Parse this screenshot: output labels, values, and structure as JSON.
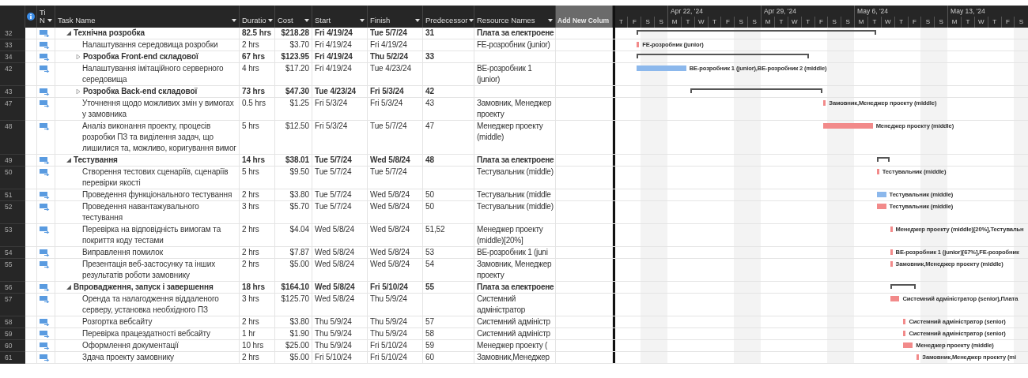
{
  "columns": [
    {
      "label": "Ti N",
      "kind": "field"
    },
    {
      "label": "Task Name",
      "kind": "field"
    },
    {
      "label": "Duratio",
      "kind": "field"
    },
    {
      "label": "Cost",
      "kind": "field"
    },
    {
      "label": "Start",
      "kind": "field"
    },
    {
      "label": "Finish",
      "kind": "field"
    },
    {
      "label": "Predecessor",
      "kind": "field"
    },
    {
      "label": "Resource Names",
      "kind": "field"
    },
    {
      "label": "Add New Colum",
      "kind": "add"
    }
  ],
  "timeline": {
    "weeks": [
      "Apr 22, '24",
      "Apr 29, '24",
      "May 6, '24",
      "May 13, '24"
    ],
    "days": [
      "T",
      "F",
      "S",
      "S",
      "M",
      "T",
      "W",
      "T",
      "F",
      "S",
      "S",
      "M",
      "T",
      "W",
      "T",
      "F",
      "S",
      "S",
      "M",
      "T",
      "W",
      "T",
      "F",
      "S",
      "S",
      "M",
      "T",
      "W",
      "T",
      "F",
      "S"
    ]
  },
  "tasks": [
    {
      "id": "32",
      "kind": "summary",
      "expanded": true,
      "name": "Технічна розробка",
      "duration": "82.5 hrs",
      "cost": "$218.28",
      "start": "Fri 4/19/24",
      "finish": "Tue 5/7/24",
      "predecessors": "31",
      "resources": "Плата за електроене",
      "children": [
        {
          "id": "33",
          "kind": "task",
          "name": "Налаштування середовища розробки",
          "duration": "2 hrs",
          "cost": "$3.70",
          "start": "Fri 4/19/24",
          "finish": "Fri 4/19/24",
          "resources": "FE-розробник (junior)",
          "critical": true,
          "bar_label": "FE-розробник (junior)"
        },
        {
          "id": "34",
          "kind": "summary",
          "expanded": false,
          "name": "Розробка Front-end складової",
          "duration": "67 hrs",
          "cost": "$123.95",
          "start": "Fri 4/19/24",
          "finish": "Thu 5/2/24",
          "predecessors": "33"
        },
        {
          "id": "42",
          "kind": "task",
          "name": "Налаштування імітаційного серверного середовища",
          "duration": "4 hrs",
          "cost": "$17.20",
          "start": "Fri 4/19/24",
          "finish": "Tue 4/23/24",
          "resources": "BE-розробник 1 (junior)",
          "critical": false,
          "bar_label": "BE-розробник 1 (junior),BE-розробник 2 (middle)"
        },
        {
          "id": "43",
          "kind": "summary",
          "expanded": false,
          "name": "Розробка Back-end складової",
          "duration": "73 hrs",
          "cost": "$47.30",
          "start": "Tue 4/23/24",
          "finish": "Fri 5/3/24",
          "predecessors": "42"
        },
        {
          "id": "47",
          "kind": "task",
          "name": "Уточнення щодо можливих змін у вимогах у замовника",
          "duration": "0.5 hrs",
          "cost": "$1.25",
          "start": "Fri 5/3/24",
          "finish": "Fri 5/3/24",
          "predecessors": "43",
          "resources": "Замовник, Менеджер проекту",
          "critical": true,
          "bar_label": "Замовник,Менеджер проекту (middle)"
        },
        {
          "id": "48",
          "kind": "task",
          "name": "Аналіз виконання проекту, процесів розробки ПЗ та виділення задач, що лишилися та, можливо, коригування вимог",
          "duration": "5 hrs",
          "cost": "$12.50",
          "start": "Fri 5/3/24",
          "finish": "Tue 5/7/24",
          "predecessors": "47",
          "resources": "Менеджер проекту (middle)",
          "critical": true,
          "bar_label": "Менеджер проекту (middle)"
        }
      ]
    },
    {
      "id": "49",
      "kind": "summary",
      "expanded": true,
      "name": "Тестування",
      "duration": "14 hrs",
      "cost": "$38.01",
      "start": "Tue 5/7/24",
      "finish": "Wed 5/8/24",
      "predecessors": "48",
      "resources": "Плата за електроене",
      "children": [
        {
          "id": "50",
          "kind": "task",
          "name": "Створення тестових сценаріїв, сценаріїв перевірки якості",
          "duration": "5 hrs",
          "cost": "$9.50",
          "start": "Tue 5/7/24",
          "finish": "Tue 5/7/24",
          "resources": "Тестувальник (middle)",
          "critical": true,
          "bar_label": "Тестувальник (middle)"
        },
        {
          "id": "51",
          "kind": "task",
          "name": "Проведення функціонального тестування",
          "duration": "2 hrs",
          "cost": "$3.80",
          "start": "Tue 5/7/24",
          "finish": "Wed 5/8/24",
          "predecessors": "50",
          "resources": "Тестувальник (middle",
          "critical": false,
          "bar_label": "Тестувальник (middle)"
        },
        {
          "id": "52",
          "kind": "task",
          "name": "Проведення навантажувального тестування",
          "duration": "3 hrs",
          "cost": "$5.70",
          "start": "Tue 5/7/24",
          "finish": "Wed 5/8/24",
          "predecessors": "50",
          "resources": "Тестувальник (middle)",
          "critical": true,
          "bar_label": "Тестувальник (middle)"
        },
        {
          "id": "53",
          "kind": "task",
          "name": "Перевірка на відповідність вимогам та покриття коду тестами",
          "duration": "2 hrs",
          "cost": "$4.04",
          "start": "Wed 5/8/24",
          "finish": "Wed 5/8/24",
          "predecessors": "51,52",
          "resources": "Менеджер проекту (middle)[20%]",
          "critical": true,
          "bar_label": "Менеджер проекту (middle)[20%],Тестувальн"
        },
        {
          "id": "54",
          "kind": "task",
          "name": "Виправлення помилок",
          "duration": "2 hrs",
          "cost": "$7.87",
          "start": "Wed 5/8/24",
          "finish": "Wed 5/8/24",
          "predecessors": "53",
          "resources": "BE-розробник 1 (juni",
          "critical": true,
          "bar_label": "BE-розробник 1 (junior)[67%],FE-розробник"
        },
        {
          "id": "55",
          "kind": "task",
          "name": "Презентація веб-застосунку та інших результатів роботи замовнику",
          "duration": "2 hrs",
          "cost": "$5.00",
          "start": "Wed 5/8/24",
          "finish": "Wed 5/8/24",
          "predecessors": "54",
          "resources": "Замовник, Менеджер проекту",
          "critical": true,
          "bar_label": "Замовник,Менеджер проекту (middle)"
        }
      ]
    },
    {
      "id": "56",
      "kind": "summary",
      "expanded": true,
      "name": "Впровадження, запуск і завершення",
      "duration": "18 hrs",
      "cost": "$164.10",
      "start": "Wed 5/8/24",
      "finish": "Fri 5/10/24",
      "predecessors": "55",
      "resources": "Плата за електроене",
      "children": [
        {
          "id": "57",
          "kind": "task",
          "name": "Оренда та налагодження віддаленого серверу, установка необхідного ПЗ",
          "duration": "3 hrs",
          "cost": "$125.70",
          "start": "Wed 5/8/24",
          "finish": "Thu 5/9/24",
          "resources": "Системний адміністратор",
          "critical": true,
          "bar_label": "Системний адміністратор (senior),Плата"
        },
        {
          "id": "58",
          "kind": "task",
          "name": "Розгортка вебсайту",
          "duration": "2 hrs",
          "cost": "$3.80",
          "start": "Thu 5/9/24",
          "finish": "Thu 5/9/24",
          "predecessors": "57",
          "resources": "Системний адміністр",
          "critical": true,
          "bar_label": "Системний адміністратор (senior)"
        },
        {
          "id": "59",
          "kind": "task",
          "name": "Перевірка працездатності вебсайту",
          "duration": "1 hr",
          "cost": "$1.90",
          "start": "Thu 5/9/24",
          "finish": "Thu 5/9/24",
          "predecessors": "58",
          "resources": "Системний адміністр",
          "critical": true,
          "bar_label": "Системний адміністратор (senior)"
        },
        {
          "id": "60",
          "kind": "task",
          "name": "Оформлення документації",
          "duration": "10 hrs",
          "cost": "$25.00",
          "start": "Thu 5/9/24",
          "finish": "Fri 5/10/24",
          "predecessors": "59",
          "resources": "Менеджер проекту (",
          "critical": true,
          "bar_label": "Менеджер проекту (middle)"
        },
        {
          "id": "61",
          "kind": "task",
          "name": "Здача проекту замовнику",
          "duration": "2 hrs",
          "cost": "$5.00",
          "start": "Fri 5/10/24",
          "finish": "Fri 5/10/24",
          "predecessors": "60",
          "resources": "Замовник,Менеджер",
          "critical": true,
          "bar_label": "Замовник,Менеджер проекту (mi"
        }
      ]
    }
  ]
}
